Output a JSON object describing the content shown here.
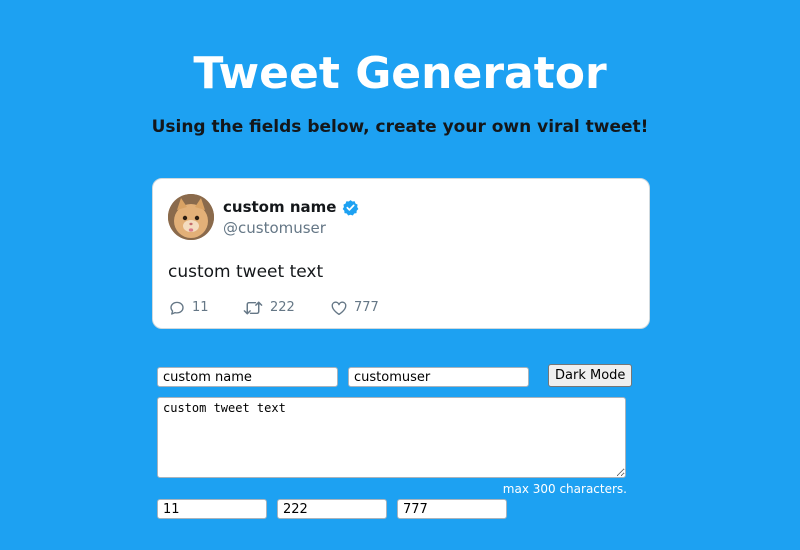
{
  "page": {
    "title": "Tweet Generator",
    "subtitle": "Using the fields below, create your own viral tweet!"
  },
  "preview": {
    "name": "custom name",
    "username": "@customuser",
    "text": "custom tweet text",
    "replies": "11",
    "retweets": "222",
    "likes": "777",
    "verified_icon": "verified-badge-icon",
    "avatar": "cat-avatar"
  },
  "form": {
    "name_value": "custom name",
    "username_value": "customuser",
    "dark_mode_label": "Dark Mode",
    "tweet_text_value": "custom tweet text",
    "max_hint": "max 300 characters.",
    "replies_value": "11",
    "retweets_value": "222",
    "likes_value": "777"
  },
  "colors": {
    "background": "#1da1f2",
    "verified": "#1da1f2",
    "muted_text": "#657786",
    "card": "#ffffff"
  }
}
